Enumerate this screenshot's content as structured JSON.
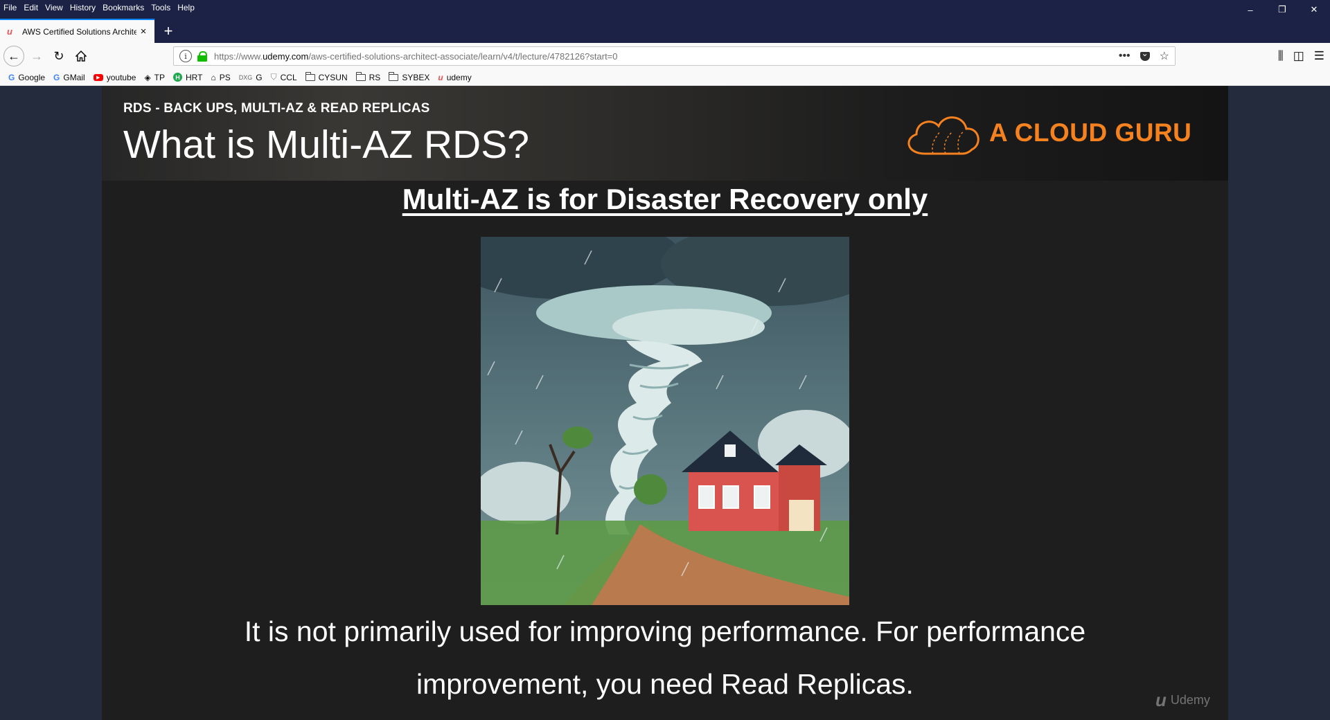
{
  "menubar": {
    "items": [
      "File",
      "Edit",
      "View",
      "History",
      "Bookmarks",
      "Tools",
      "Help"
    ]
  },
  "window_controls": {
    "minimize": "–",
    "restore": "❐",
    "close": "✕"
  },
  "tab": {
    "title": "AWS Certified Solutions Archite",
    "favicon": "udemy-icon"
  },
  "navbar": {
    "url_prefix": "https://www.",
    "url_host": "udemy.com",
    "url_path": "/aws-certified-solutions-architect-associate/learn/v4/t/lecture/4782126?start=0"
  },
  "bookmarks": [
    {
      "label": "Google",
      "icon": "google-icon"
    },
    {
      "label": "GMail",
      "icon": "google-icon"
    },
    {
      "label": "youtube",
      "icon": "youtube-icon"
    },
    {
      "label": "TP",
      "icon": "tp-icon"
    },
    {
      "label": "HRT",
      "icon": "hackerrank-icon"
    },
    {
      "label": "PS",
      "icon": "ps-icon"
    },
    {
      "label": "G",
      "icon": "dxg-icon"
    },
    {
      "label": "CCL",
      "icon": "shield-icon"
    },
    {
      "label": "CYSUN",
      "icon": "folder-icon"
    },
    {
      "label": "RS",
      "icon": "folder-icon"
    },
    {
      "label": "SYBEX",
      "icon": "folder-icon"
    },
    {
      "label": "udemy",
      "icon": "udemy-icon"
    }
  ],
  "slide": {
    "section_label": "RDS - BACK UPS, MULTI-AZ & READ REPLICAS",
    "title": "What is Multi-AZ RDS?",
    "brand": "A CLOUD GURU",
    "subtitle": "Multi-AZ is for Disaster Recovery only",
    "caption_line1": "It is not primarily used for improving performance. For performance",
    "caption_line2": "improvement, you need Read Replicas.",
    "watermark": "Udemy"
  },
  "colors": {
    "brand_orange": "#f6821f",
    "chrome_dark": "#1c2245",
    "tab_accent": "#0a84ff",
    "lock_green": "#12bc00"
  }
}
